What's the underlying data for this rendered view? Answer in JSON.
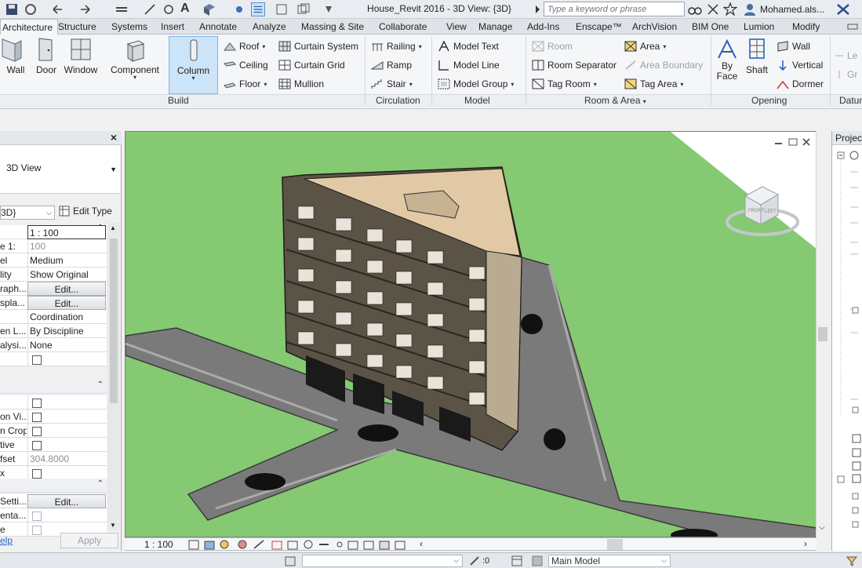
{
  "window": {
    "title": "House_Revit 2016 - 3D View: {3D}",
    "search_placeholder": "Type a keyword or phrase",
    "user": "Mohamed.als..."
  },
  "tabs": [
    "Architecture",
    "Structure",
    "Systems",
    "Insert",
    "Annotate",
    "Analyze",
    "Massing & Site",
    "Collaborate",
    "View",
    "Manage",
    "Add-Ins",
    "Enscape™",
    "ArchVision",
    "BIM One",
    "Lumion",
    "Modify"
  ],
  "ribbon": {
    "build": {
      "label": "Build",
      "wall": "Wall",
      "door": "Door",
      "window": "Window",
      "component": "Component",
      "column": "Column",
      "roof": "Roof",
      "ceiling": "Ceiling",
      "floor": "Floor",
      "curtain_system": "Curtain System",
      "curtain_grid": "Curtain Grid",
      "mullion": "Mullion"
    },
    "circulation": {
      "label": "Circulation",
      "railing": "Railing",
      "ramp": "Ramp",
      "stair": "Stair"
    },
    "model": {
      "label": "Model",
      "model_text": "Model Text",
      "model_line": "Model Line",
      "model_group": "Model Group"
    },
    "room_area": {
      "label": "Room & Area",
      "room": "Room",
      "room_separator": "Room Separator",
      "tag_room": "Tag Room",
      "area": "Area",
      "area_boundary": "Area Boundary",
      "tag_area": "Tag Area"
    },
    "opening": {
      "label": "Opening",
      "by_face": "By Face",
      "by_face_2": "Face",
      "by_face_1": "By",
      "shaft": "Shaft",
      "wall": "Wall",
      "vertical": "Vertical",
      "dormer": "Dormer"
    },
    "datum": {
      "label": "Datum",
      "level": "Le",
      "grid": "Gr"
    }
  },
  "properties": {
    "type_name": "3D View",
    "filter": "3D}",
    "edit_type": "Edit Type",
    "rows": [
      {
        "key": "",
        "value": "1 : 100",
        "style": "boxed"
      },
      {
        "key": "e  1:",
        "value": "100",
        "style": "grey"
      },
      {
        "key": "el",
        "value": "Medium"
      },
      {
        "key": "lity",
        "value": "Show Original"
      },
      {
        "key": "raph...",
        "value": "Edit...",
        "style": "btn"
      },
      {
        "key": "spla...",
        "value": "Edit...",
        "style": "btn"
      },
      {
        "key": "",
        "value": "Coordination"
      },
      {
        "key": "en L...",
        "value": "By Discipline"
      },
      {
        "key": "alysi...",
        "value": "None"
      },
      {
        "key": "",
        "value": "",
        "style": "check"
      }
    ],
    "rows2": [
      {
        "key": "",
        "value": "",
        "style": "check"
      },
      {
        "key": "on Vi...",
        "value": "",
        "style": "check"
      },
      {
        "key": "n Crop",
        "value": "",
        "style": "check"
      },
      {
        "key": "tive",
        "value": "",
        "style": "check"
      },
      {
        "key": "fset",
        "value": "304.8000",
        "style": "grey"
      },
      {
        "key": "x",
        "value": "",
        "style": "check"
      }
    ],
    "rows3": [
      {
        "key": " Setti...",
        "value": "Edit...",
        "style": "btn"
      },
      {
        "key": "enta...",
        "value": "",
        "style": "checkgrey"
      },
      {
        "key": "e",
        "value": "",
        "style": "checkgrey"
      }
    ],
    "help": "elp",
    "apply": "Apply"
  },
  "view": {
    "scale": "1 : 100",
    "viewcube_face_front": "FRONT",
    "viewcube_face_left": "LEFT"
  },
  "browser": {
    "title": "Project"
  },
  "statusbar": {
    "count": ":0",
    "model": "Main Model"
  },
  "colors": {
    "grass": "#85c972",
    "road": "#7a7a7a",
    "building_wall": "#5b5446",
    "building_side": "#b9ab92",
    "roof": "#e2c9a6",
    "active_tab": "#f5f6f8",
    "selected_tool": "#cce4f7"
  }
}
